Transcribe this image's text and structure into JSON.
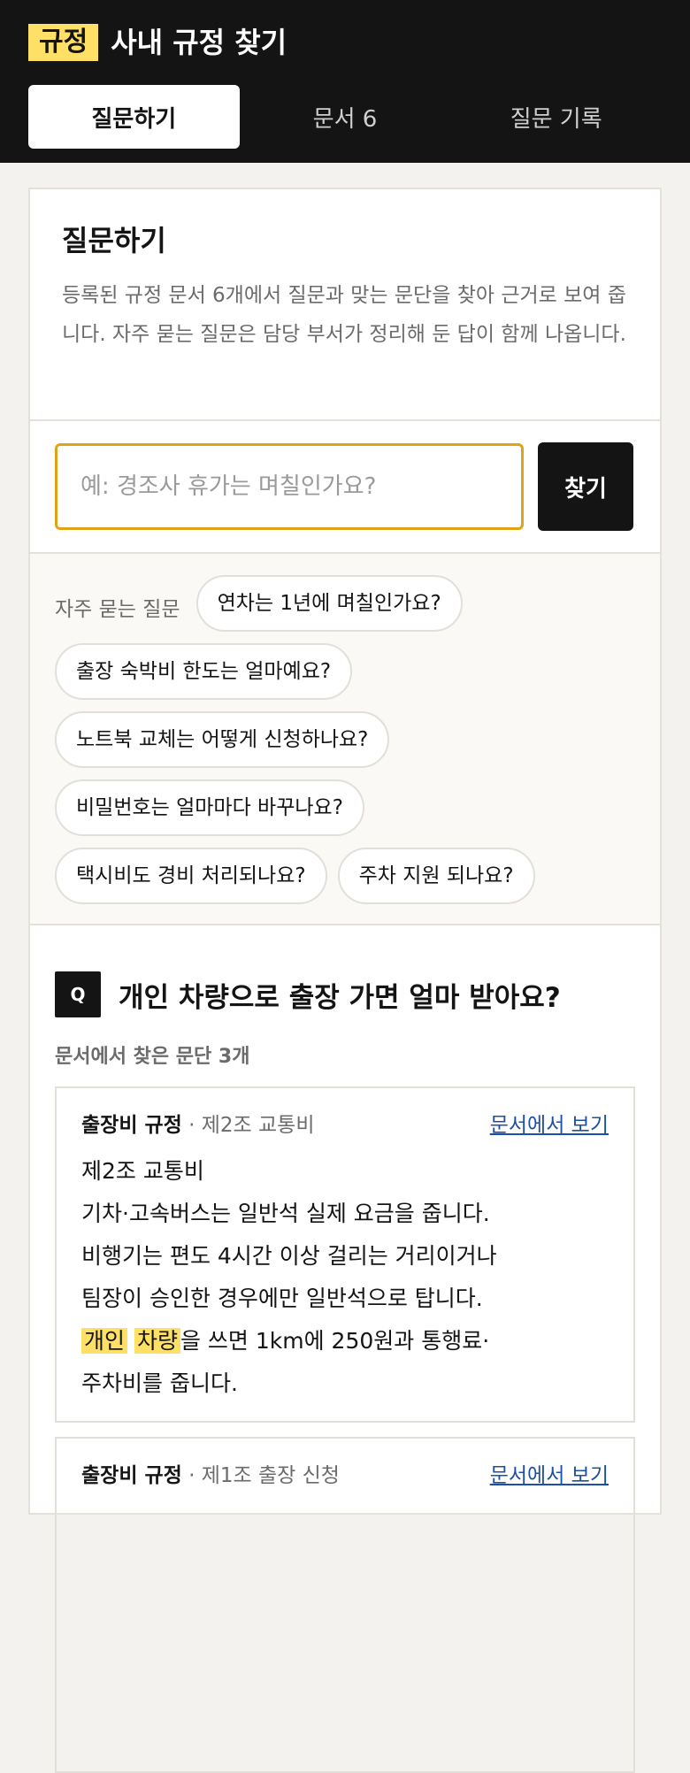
{
  "header": {
    "badge": "규정",
    "title": "사내 규정 찾기",
    "tabs": [
      {
        "label": "질문하기",
        "active": true
      },
      {
        "label": "문서 6",
        "active": false
      },
      {
        "label": "질문 기록",
        "active": false
      }
    ]
  },
  "intro": {
    "title": "질문하기",
    "description": "등록된 규정 문서 6개에서 질문과 맞는 문단을 찾아 근거로 보여 줍니다. 자주 묻는 질문은 담당 부서가 정리해 둔 답이 함께 나옵니다."
  },
  "search": {
    "placeholder": "예: 경조사 휴가는 며칠인가요?",
    "value": "",
    "button": "찾기"
  },
  "faq": {
    "label": "자주 묻는 질문",
    "items": [
      "연차는 1년에 며칠인가요?",
      "출장 숙박비 한도는 얼마예요?",
      "노트북 교체는 어떻게 신청하나요?",
      "비밀번호는 얼마마다 바꾸나요?",
      "택시비도 경비 처리되나요?",
      "주차 지원 되나요?"
    ]
  },
  "answer": {
    "badge": "Q",
    "question": "개인 차량으로 출장 가면 얼마 받아요?",
    "found": "문서에서 찾은 문단 3개",
    "passages": [
      {
        "doc": "출장비 규정",
        "section": " · 제2조 교통비",
        "link": "문서에서 보기",
        "lines": [
          "제2조 교통비",
          "기차·고속버스는 일반석 실제 요금을 줍니다.",
          "비행기는 편도 4시간 이상 걸리는 거리이거나",
          "팀장이 승인한 경우에만 일반석으로 탑니다."
        ],
        "hl1": "개인",
        "hl2": "차량",
        "after_hl": "을 쓰면 1km에 250원과 통행료·",
        "last_line": "주차비를 줍니다."
      },
      {
        "doc": "출장비 규정",
        "section": " · 제1조 출장 신청",
        "link": "문서에서 보기"
      }
    ]
  },
  "colors": {
    "header_bg": "#141414",
    "accent_yellow": "#ffe066",
    "input_border": "#e0a318",
    "link": "#1e4fa8"
  }
}
